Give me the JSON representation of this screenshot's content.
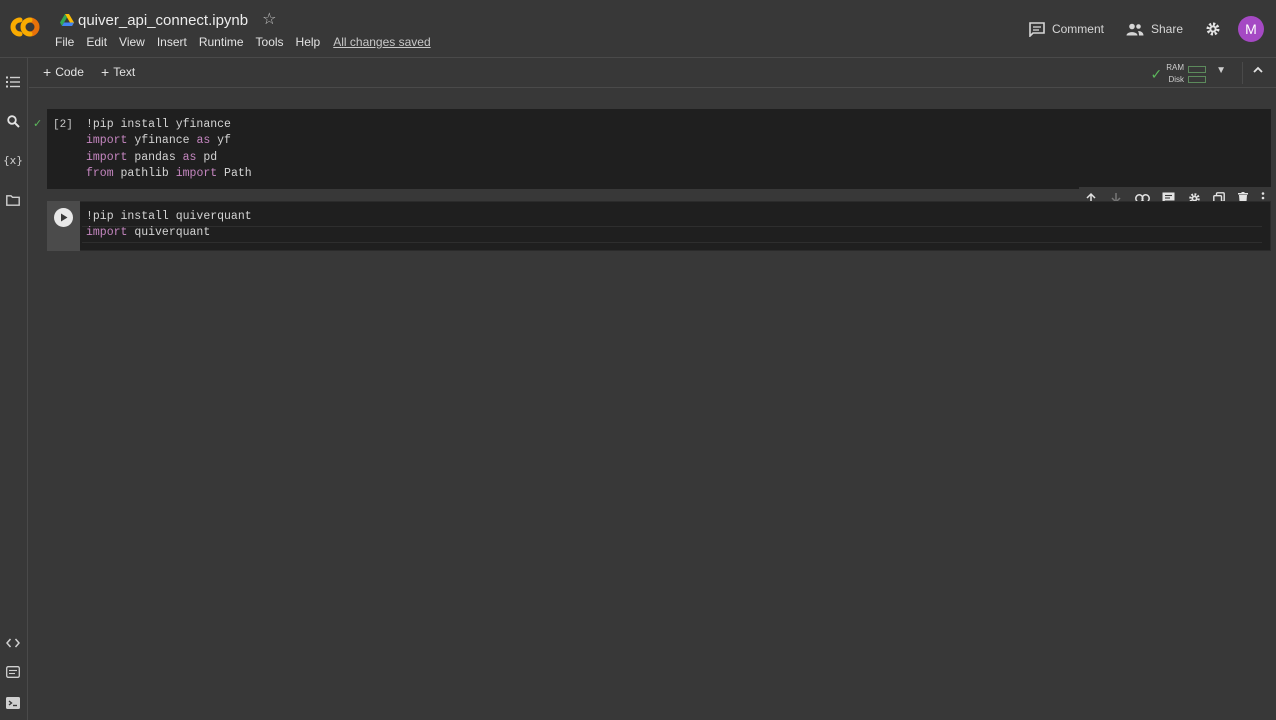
{
  "header": {
    "notebook_title": "quiver_api_connect.ipynb",
    "menu": [
      "File",
      "Edit",
      "View",
      "Insert",
      "Runtime",
      "Tools",
      "Help"
    ],
    "save_status": "All changes saved",
    "comment_label": "Comment",
    "share_label": "Share",
    "avatar_letter": "M",
    "avatar_color": "#a549c4"
  },
  "toolbar": {
    "add_code_label": "Code",
    "add_text_label": "Text",
    "ram_label": "RAM",
    "disk_label": "Disk"
  },
  "rail": {
    "variables_label": "{x}"
  },
  "cells": [
    {
      "execution_count": "[2]",
      "lines": [
        {
          "parts": [
            {
              "t": "!pip install yfinance",
              "k": false
            }
          ]
        },
        {
          "parts": [
            {
              "t": "import",
              "k": true
            },
            {
              "t": " yfinance ",
              "k": false
            },
            {
              "t": "as",
              "k": true
            },
            {
              "t": " yf",
              "k": false
            }
          ]
        },
        {
          "parts": [
            {
              "t": "import",
              "k": true
            },
            {
              "t": " pandas ",
              "k": false
            },
            {
              "t": "as",
              "k": true
            },
            {
              "t": " pd",
              "k": false
            }
          ]
        },
        {
          "parts": [
            {
              "t": "from",
              "k": true
            },
            {
              "t": " pathlib ",
              "k": false
            },
            {
              "t": "import",
              "k": true
            },
            {
              "t": " Path",
              "k": false
            }
          ]
        }
      ]
    },
    {
      "execution_count": "",
      "lines": [
        {
          "parts": [
            {
              "t": "!pip install quiverquant",
              "k": false
            }
          ]
        },
        {
          "parts": [
            {
              "t": "import",
              "k": true
            },
            {
              "t": " quiverquant",
              "k": false
            }
          ]
        }
      ]
    }
  ],
  "colors": {
    "background": "#383838",
    "cell_background": "#1f1f1f",
    "keyword": "#c586c0",
    "success": "#5cb85c"
  }
}
